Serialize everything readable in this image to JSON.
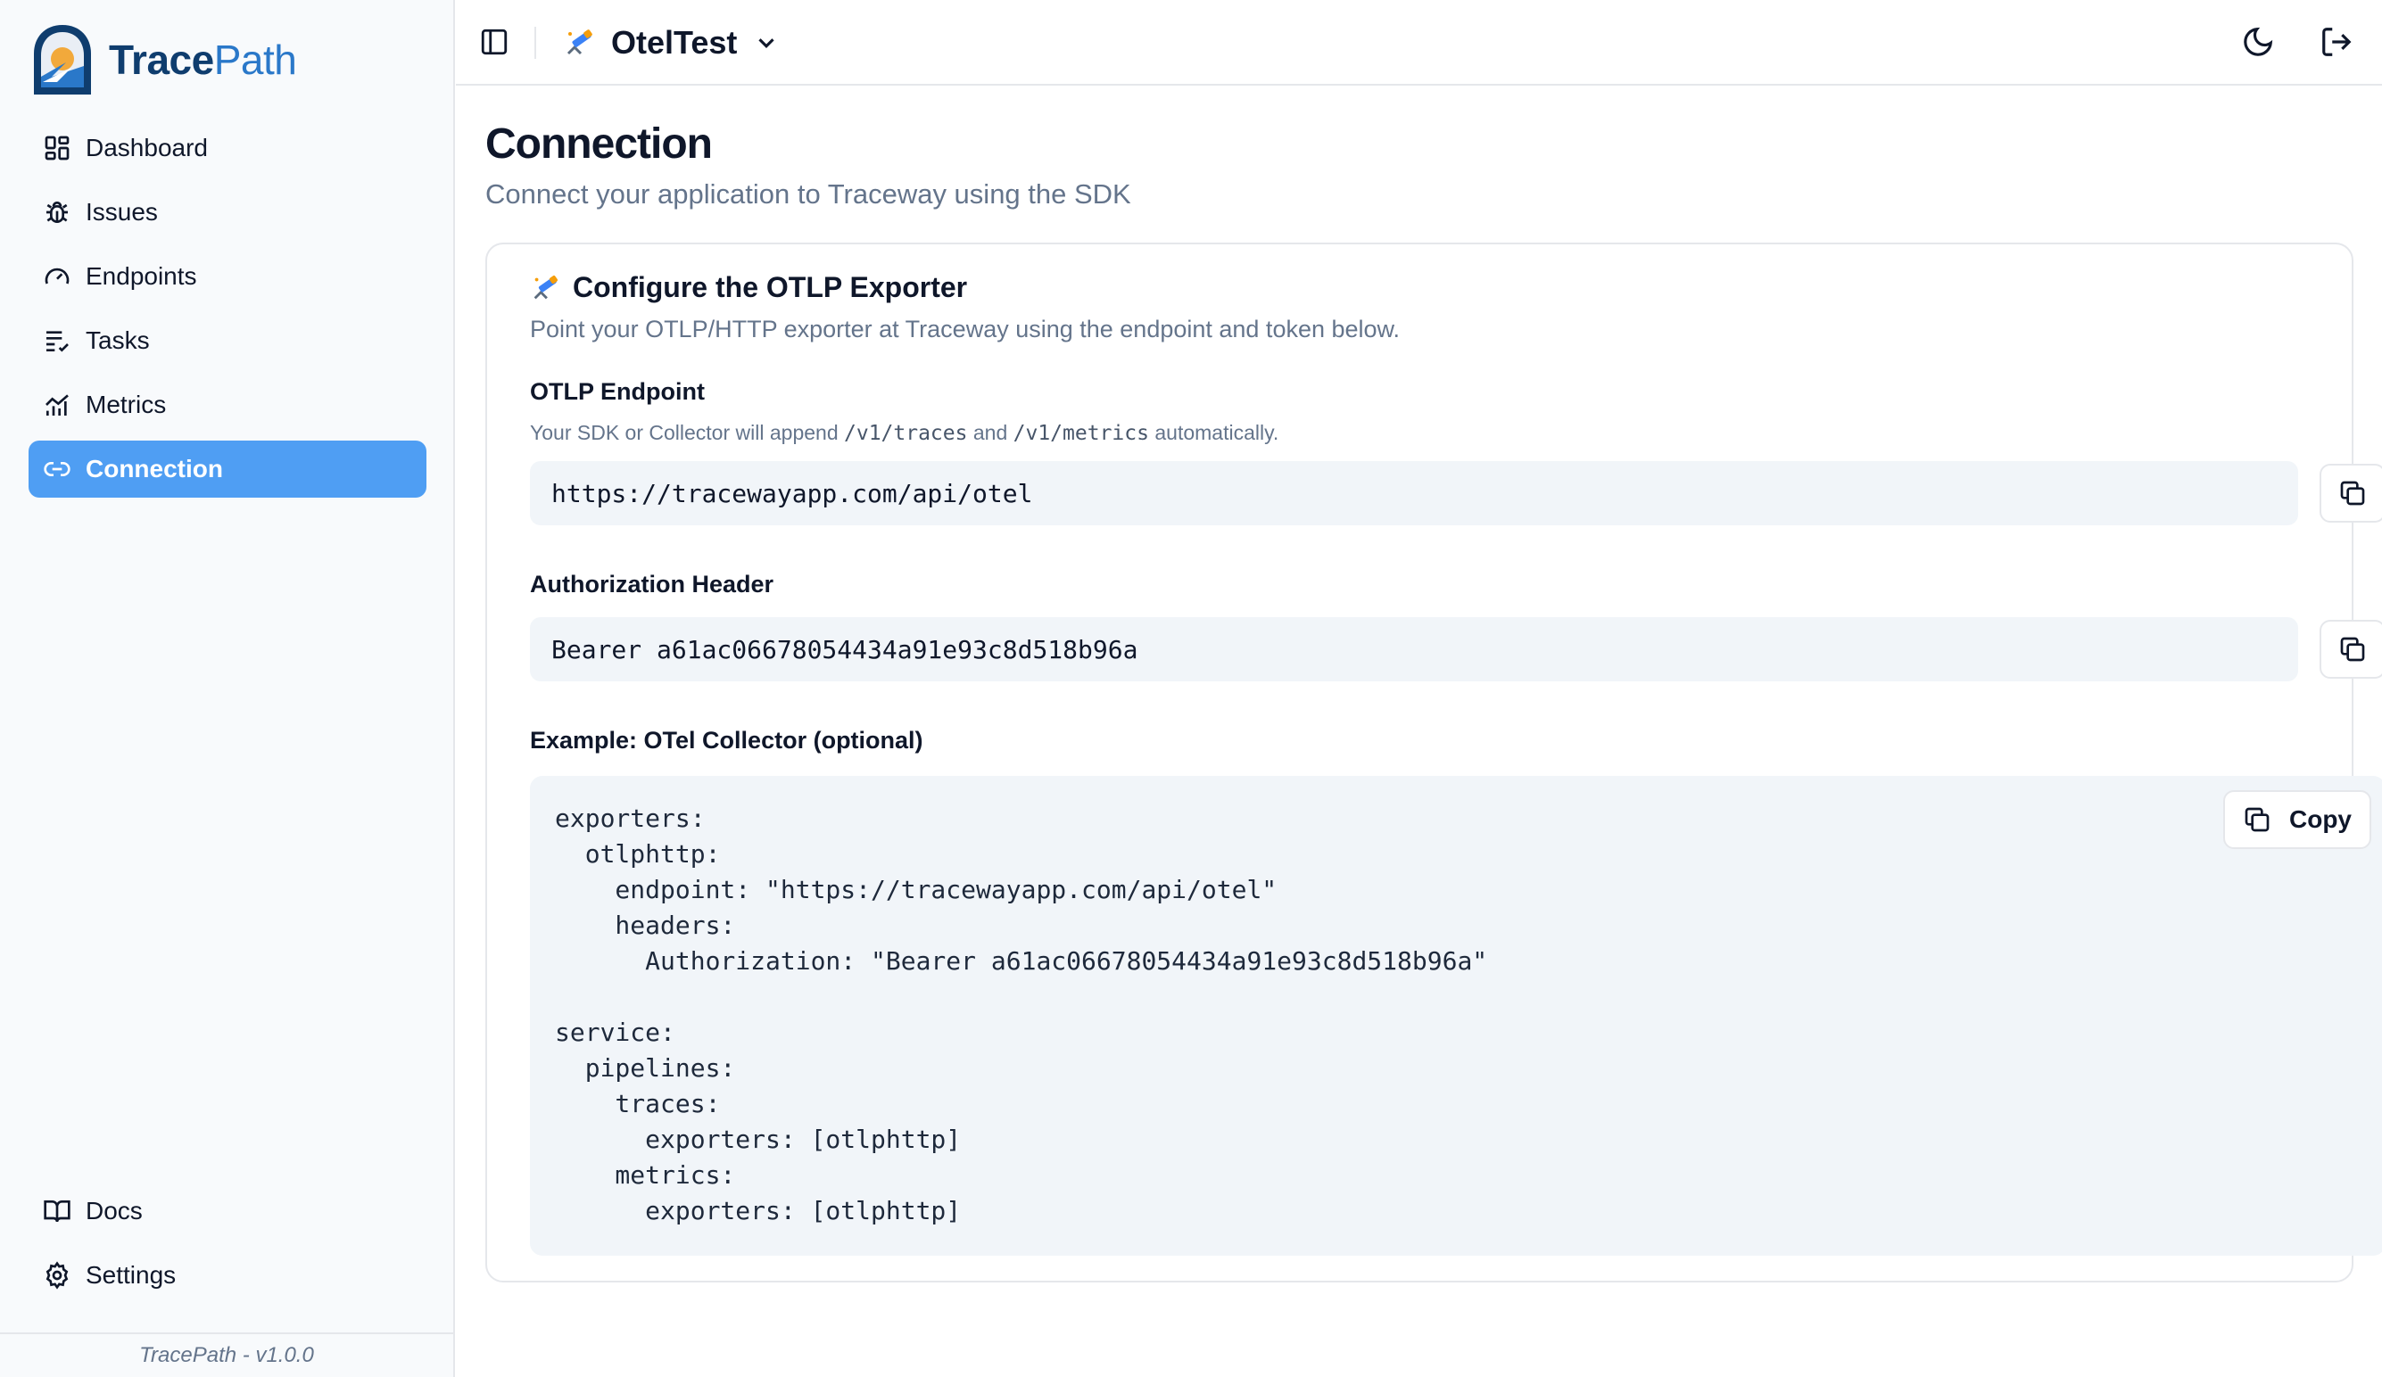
{
  "brand": {
    "name_part1": "Trace",
    "name_part2": "Path",
    "version": "TracePath - v1.0.0"
  },
  "sidebar": {
    "items": [
      {
        "label": "Dashboard",
        "icon": "dashboard-icon"
      },
      {
        "label": "Issues",
        "icon": "bug-icon"
      },
      {
        "label": "Endpoints",
        "icon": "gauge-icon"
      },
      {
        "label": "Tasks",
        "icon": "tasks-icon"
      },
      {
        "label": "Metrics",
        "icon": "chart-icon"
      },
      {
        "label": "Connection",
        "icon": "link-icon",
        "active": true
      }
    ],
    "bottom_items": [
      {
        "label": "Docs",
        "icon": "book-icon"
      },
      {
        "label": "Settings",
        "icon": "gear-icon"
      }
    ]
  },
  "header": {
    "project_name": "OtelTest",
    "project_icon": "telescope-icon"
  },
  "page": {
    "title": "Connection",
    "subtitle": "Connect your application to Traceway using the SDK"
  },
  "card": {
    "title": "Configure the OTLP Exporter",
    "subtitle": "Point your OTLP/HTTP exporter at Traceway using the endpoint and token below.",
    "endpoint": {
      "label": "OTLP Endpoint",
      "hint_prefix": "Your SDK or Collector will append",
      "hint_code1": "/v1/traces",
      "hint_and": "and",
      "hint_code2": "/v1/metrics",
      "hint_suffix": "automatically.",
      "value": "https://tracewayapp.com/api/otel"
    },
    "auth": {
      "label": "Authorization Header",
      "value": "Bearer a61ac06678054434a91e93c8d518b96a"
    },
    "example": {
      "label": "Example: OTel Collector (optional)",
      "copy_label": "Copy",
      "code": "exporters:\n  otlphttp:\n    endpoint: \"https://tracewayapp.com/api/otel\"\n    headers:\n      Authorization: \"Bearer a61ac06678054434a91e93c8d518b96a\"\n\nservice:\n  pipelines:\n    traces:\n      exporters: [otlphttp]\n    metrics:\n      exporters: [otlphttp]"
    }
  },
  "colors": {
    "accent": "#4f9ef3",
    "muted": "#64748b",
    "surface": "#f1f5f9"
  }
}
